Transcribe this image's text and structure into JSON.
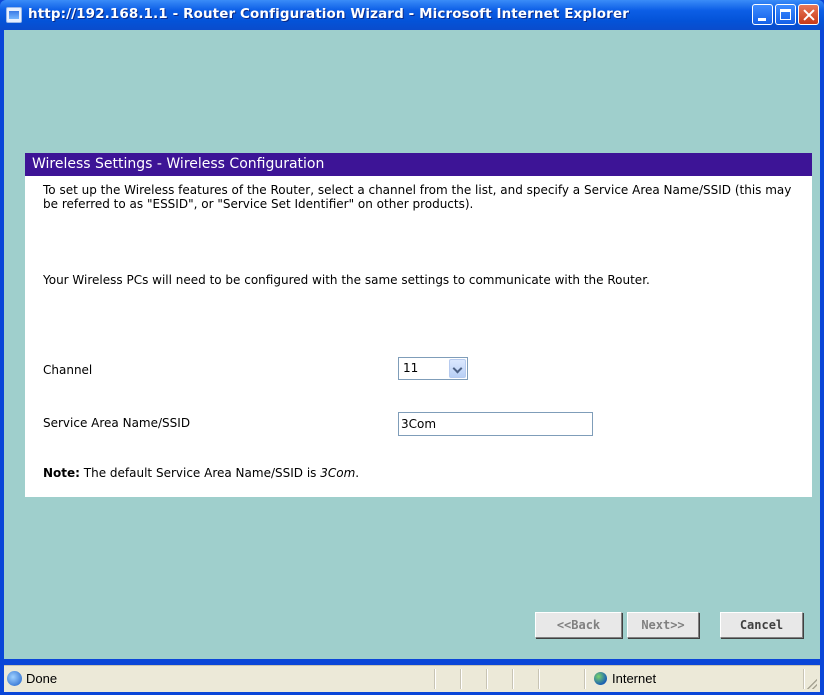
{
  "window": {
    "title": "http://192.168.1.1 - Router Configuration Wizard - Microsoft Internet Explorer"
  },
  "wizard": {
    "header": "Wireless Settings - Wireless Configuration",
    "intro": "To set up the Wireless features of the Router, select a channel from the list, and specify a Service Area Name/SSID (this may be referred to as \"ESSID\", or \"Service Set Identifier\" on other products).",
    "instruction": "Your Wireless PCs will need to be configured with the same settings to communicate with the Router.",
    "channel_label": "Channel",
    "channel_value": "11",
    "ssid_label": "Service Area Name/SSID",
    "ssid_value": "3Com",
    "note_label": "Note:",
    "note_text": " The default Service Area Name/SSID is ",
    "note_value": "3Com",
    "note_end": "."
  },
  "buttons": {
    "back": "<<Back",
    "next": "Next>>",
    "cancel": "Cancel"
  },
  "statusbar": {
    "status": "Done",
    "zone": "Internet"
  },
  "colors": {
    "header_bg": "#3d1496",
    "page_bg": "#9fcfcc",
    "titlebar": "#0453d8"
  }
}
